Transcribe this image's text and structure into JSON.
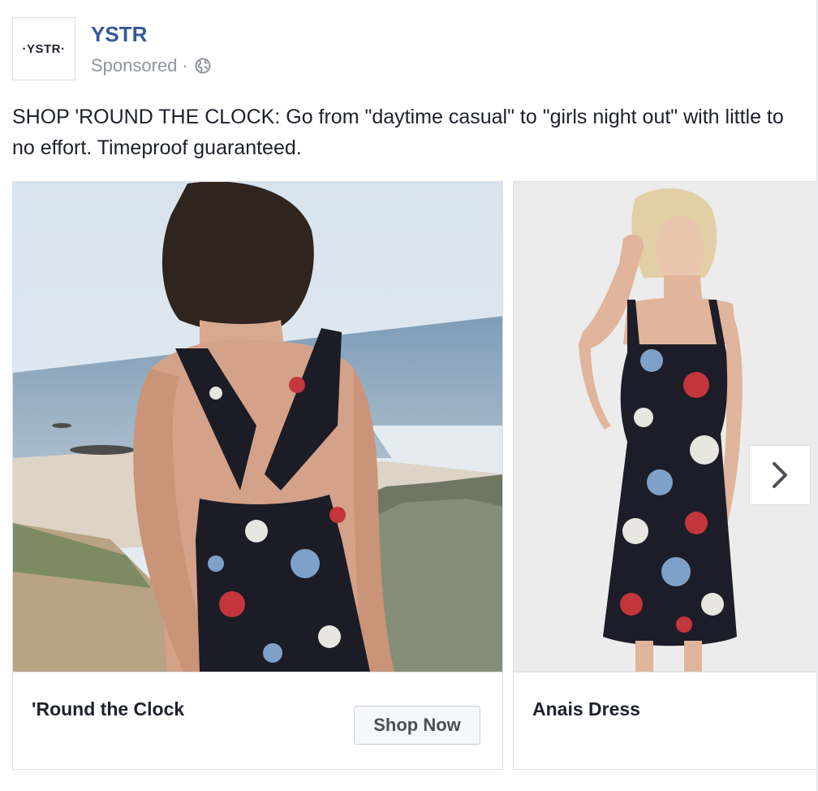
{
  "page": {
    "name": "YSTR",
    "logo_text": "·YSTR·",
    "sponsored_label": "Sponsored",
    "separator": "·"
  },
  "post": {
    "text": "SHOP 'ROUND THE CLOCK: Go from \"daytime casual\" to \"girls night out\" with little to no effort. Timeproof guaranteed."
  },
  "carousel": {
    "cards": [
      {
        "title": "'Round the Clock",
        "cta": "Shop Now",
        "image": "woman-back-view-floral-dress-beach"
      },
      {
        "title": "Anais Dress",
        "image": "model-floral-dress-studio"
      }
    ],
    "next_icon": "chevron-right-icon"
  },
  "colors": {
    "page_name": "#365899",
    "meta_text": "#90949c",
    "body_text": "#1d2129",
    "border": "#dddfe2"
  }
}
